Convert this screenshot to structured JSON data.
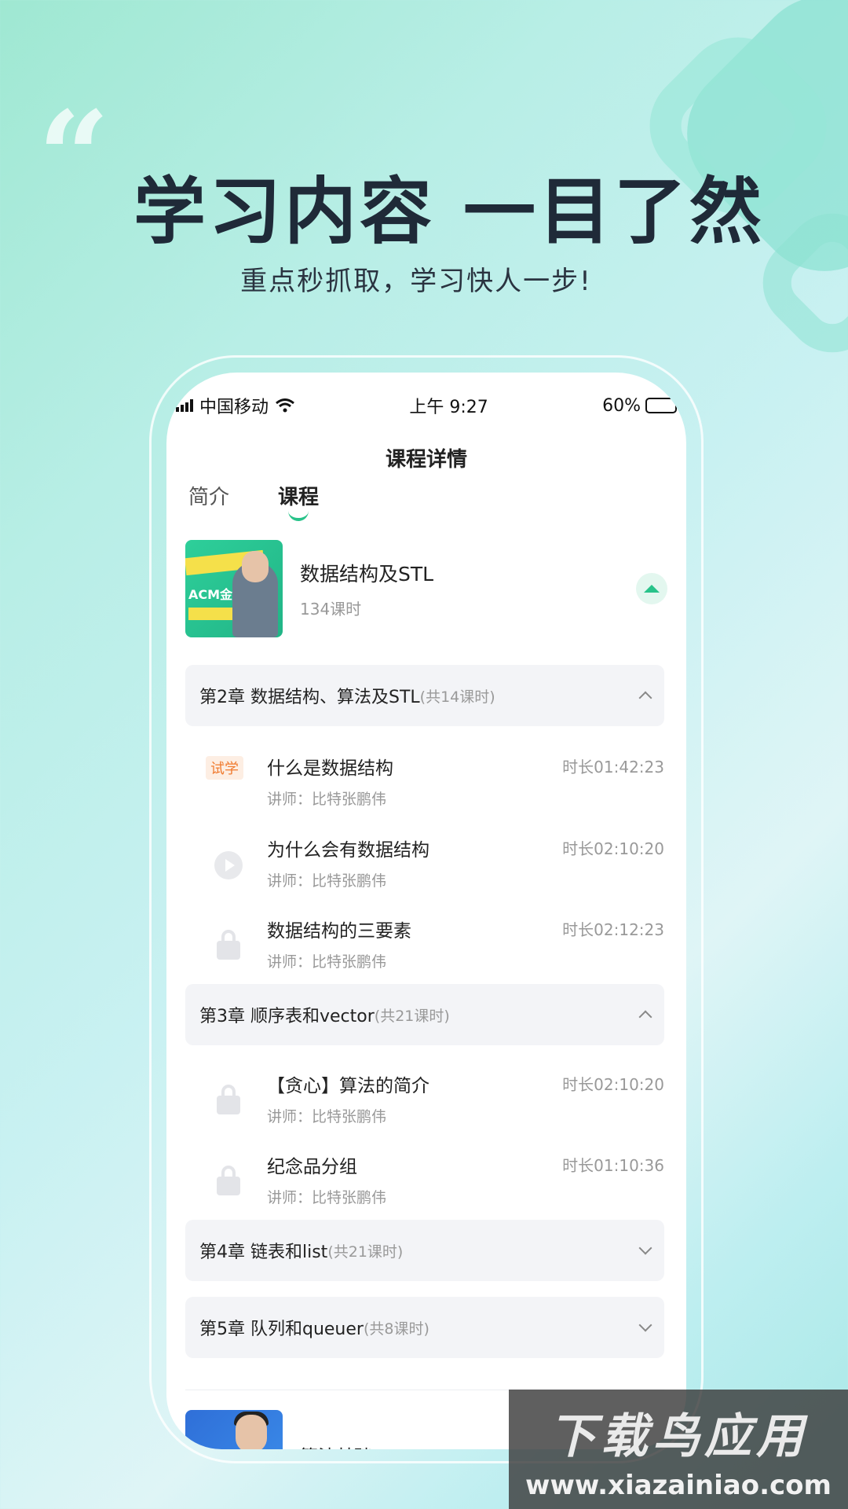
{
  "hero": {
    "quote_mark": "“",
    "headline": "学习内容 一目了然",
    "subline": "重点秒抓取，学习快人一步!"
  },
  "status_bar": {
    "carrier": "中国移动",
    "time": "上午 9:27",
    "battery": "60%",
    "battery_level": 0.6
  },
  "page": {
    "title": "课程详情",
    "tabs": [
      {
        "label": "简介",
        "active": false
      },
      {
        "label": "课程",
        "active": true
      }
    ]
  },
  "course": {
    "name": "数据结构及STL",
    "count": "134课时",
    "thumb_text": "ACM金牌"
  },
  "chapters": [
    {
      "title": "第2章  数据结构、算法及STL",
      "count": "(共14课时)",
      "expanded": true
    },
    {
      "title": "第3章  顺序表和vector",
      "count": "(共21课时)",
      "expanded": true
    },
    {
      "title": "第4章  链表和list",
      "count": "(共21课时)",
      "expanded": false
    },
    {
      "title": "第5章  队列和queuer",
      "count": "(共8课时)",
      "expanded": false
    }
  ],
  "lessons": [
    {
      "title": "什么是数据结构",
      "teacher": "讲师：比特张鹏伟",
      "duration": "时长01:42:23",
      "badge": "试学",
      "icon": "trial-badge"
    },
    {
      "title": "为什么会有数据结构",
      "teacher": "讲师：比特张鹏伟",
      "duration": "时长02:10:20",
      "icon": "play-icon"
    },
    {
      "title": "数据结构的三要素",
      "teacher": "讲师：比特张鹏伟",
      "duration": "时长02:12:23",
      "icon": "lock-icon"
    },
    {
      "title": "【贪心】算法的简介",
      "teacher": "讲师：比特张鹏伟",
      "duration": "时长02:10:20",
      "icon": "lock-icon"
    },
    {
      "title": "纪念品分组",
      "teacher": "讲师：比特张鹏伟",
      "duration": "时长01:10:36",
      "icon": "lock-icon"
    }
  ],
  "next_course": {
    "name": "算法基础"
  },
  "watermark": {
    "cn": "下载鸟应用",
    "url": "www.xiazainiao.com"
  },
  "colors": {
    "accent": "#28c38a",
    "trial": "#f07a2e",
    "headline": "#1f2a38"
  }
}
